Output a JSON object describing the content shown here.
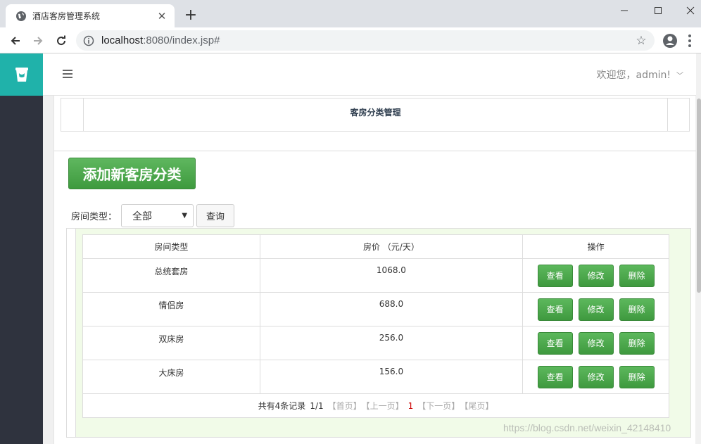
{
  "browser": {
    "tab_title": "酒店客房管理系统",
    "new_tab": "+",
    "url_host": "localhost",
    "url_rest": ":8080/index.jsp#"
  },
  "header": {
    "welcome": "欢迎您，admin!"
  },
  "page": {
    "section_title": "客房分类管理",
    "add_button": "添加新客房分类"
  },
  "filter": {
    "label": "房间类型：",
    "selected": "全部",
    "query_button": "查询"
  },
  "table": {
    "headers": [
      "房间类型",
      "房价 （元/天）",
      "操作"
    ],
    "rows": [
      {
        "type": "总统套房",
        "price": "1068.0"
      },
      {
        "type": "情侣房",
        "price": "688.0"
      },
      {
        "type": "双床房",
        "price": "256.0"
      },
      {
        "type": "大床房",
        "price": "156.0"
      }
    ],
    "actions": {
      "view": "查看",
      "edit": "修改",
      "delete": "删除"
    }
  },
  "pager": {
    "total": "共有4条记录",
    "pages": "1/1",
    "first": "【首页】",
    "prev": "【上一页】",
    "current": "1",
    "next": "【下一页】",
    "last": "【尾页】"
  },
  "watermark": "https://blog.csdn.net/weixin_42148410",
  "colors": {
    "logo_bg": "#20b2aa",
    "sidebar_bg": "#2f333e",
    "green_button": "#4cae4c",
    "grid_bg": "#f1fbe8"
  }
}
